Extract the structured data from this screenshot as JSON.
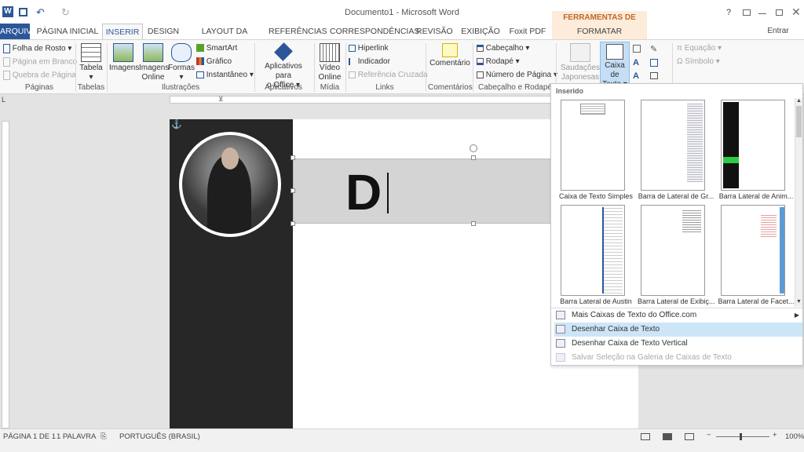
{
  "window": {
    "title": "Documento1 - Microsoft Word",
    "tools_header": "FERRAMENTAS DE DESENHO",
    "user": "Entrar",
    "help": "?"
  },
  "tabs": [
    "ARQUIVO",
    "PÁGINA INICIAL",
    "INSERIR",
    "DESIGN",
    "LAYOUT DA PÁGINA",
    "REFERÊNCIAS",
    "CORRESPONDÊNCIAS",
    "REVISÃO",
    "EXIBIÇÃO",
    "Foxit PDF",
    "FORMATAR"
  ],
  "ribbon": {
    "paginas": {
      "label": "Páginas",
      "items": [
        "Folha de Rosto",
        "Página em Branco",
        "Quebra de Página"
      ]
    },
    "tabelas": {
      "label": "Tabelas",
      "button": "Tabela"
    },
    "ilustracoes": {
      "label": "Ilustrações",
      "imagens": "Imagens",
      "imagens_online_1": "Imagens",
      "imagens_online_2": "Online",
      "formas": "Formas",
      "smartart": "SmartArt",
      "grafico": "Gráfico",
      "instantaneo": "Instantâneo"
    },
    "aplicativos": {
      "label": "Aplicativos",
      "btn_1": "Aplicativos para",
      "btn_2": "o Office"
    },
    "midia": {
      "label": "Mídia",
      "btn_1": "Vídeo",
      "btn_2": "Online"
    },
    "links": {
      "label": "Links",
      "hiperlink": "Hiperlink",
      "indicador": "Indicador",
      "referencia": "Referência Cruzada"
    },
    "comentarios": {
      "label": "Comentários",
      "btn": "Comentário"
    },
    "cabecalho": {
      "label": "Cabeçalho e Rodapé",
      "cabecalho": "Cabeçalho",
      "rodape": "Rodapé",
      "numero": "Número de Página"
    },
    "texto": {
      "saudacoes_1": "Saudações",
      "saudacoes_2": "Japonesas",
      "caixa_1": "Caixa de",
      "caixa_2": "Texto"
    },
    "simbolos": {
      "equacao": "Equação",
      "simbolo": "Símbolo"
    }
  },
  "document": {
    "textbox_text": "D"
  },
  "dropdown": {
    "header": "Inserido",
    "captions": [
      "Caixa de Texto Simples",
      "Barra de Lateral de Gr...",
      "Barra Lateral de Anim...",
      "Barra Lateral de Austin",
      "Barra Lateral de Exibiç...",
      "Barra Lateral de Facet..."
    ],
    "menu": [
      "Mais Caixas de Texto do Office.com",
      "Desenhar Caixa de Texto",
      "Desenhar Caixa de Texto Vertical",
      "Salvar Seleção na Galeria de Caixas de Texto"
    ]
  },
  "status": {
    "page": "PÁGINA 1 DE 1",
    "words": "1 PALAVRA",
    "language": "PORTUGUÊS (BRASIL)",
    "zoom": "100%"
  },
  "colors": {
    "accent": "#2b579a",
    "tools": "#c0672b"
  }
}
